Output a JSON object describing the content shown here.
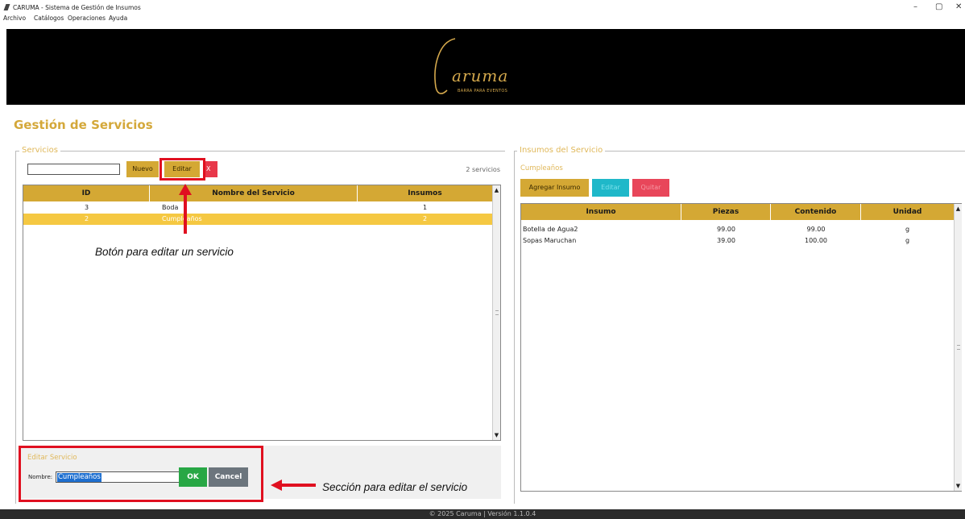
{
  "window": {
    "title": "CARUMA - Sistema de Gestión de Insumos",
    "minimize": "–",
    "maximize": "▢",
    "close": "✕"
  },
  "menu": [
    "Archivo",
    "Catálogos",
    "Operaciones",
    "Ayuda"
  ],
  "banner": {
    "logo_text": "aruma",
    "logo_subtitle": "BARRA PARA EVENTOS",
    "brand_color": "#d4a84c"
  },
  "page_title": "Gestión de Servicios",
  "servicios": {
    "group_label": "Servicios",
    "search_value": "",
    "buttons": {
      "nuevo": "Nuevo",
      "editar": "Editar",
      "delete": "X"
    },
    "count_text": "2 servicios",
    "columns": [
      "ID",
      "Nombre del Servicio",
      "Insumos"
    ],
    "rows": [
      {
        "id": "3",
        "nombre": "Boda",
        "insumos": "1",
        "selected": false
      },
      {
        "id": "2",
        "nombre": "Cumpleaños",
        "insumos": "2",
        "selected": true
      }
    ]
  },
  "edit_section": {
    "title": "Editar Servicio",
    "name_label": "Nombre:",
    "name_value": "Cumpleaños",
    "ok": "OK",
    "cancel": "Cancel"
  },
  "insumos": {
    "group_label": "Insumos del Servicio",
    "selected_service": "Cumpleaños",
    "buttons": {
      "agregar": "Agregar Insumo",
      "editar": "Editar",
      "quitar": "Quitar"
    },
    "columns": [
      "Insumo",
      "Piezas",
      "Contenido",
      "Unidad"
    ],
    "rows": [
      {
        "insumo": "Botella de Agua2",
        "piezas": "99.00",
        "contenido": "99.00",
        "unidad": "g"
      },
      {
        "insumo": "Sopas Maruchan",
        "piezas": "39.00",
        "contenido": "100.00",
        "unidad": "g"
      }
    ]
  },
  "annotations": {
    "edit_button_note": "Botón para editar un servicio",
    "edit_section_note": "Sección para editar el servicio",
    "color": "#e01020"
  },
  "footer": "© 2025 Caruma | Versión 1.1.0.4"
}
